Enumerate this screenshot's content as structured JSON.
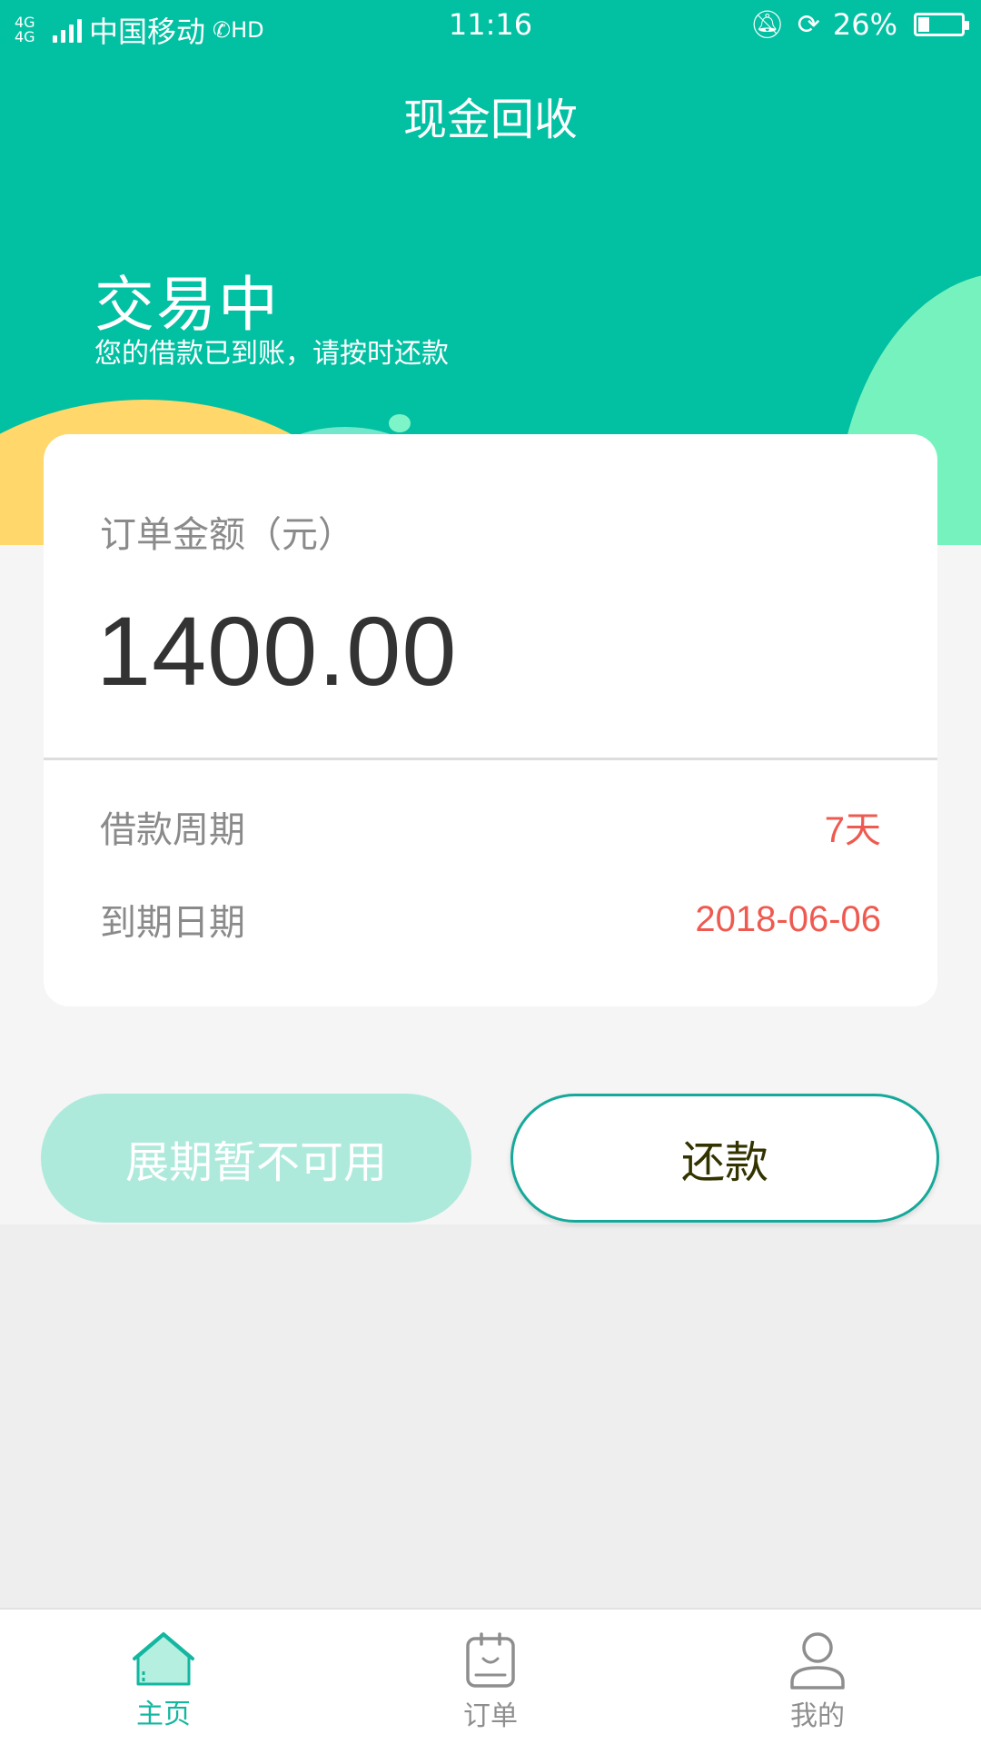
{
  "status_bar": {
    "network": "4G 4G",
    "carrier": "中国移动",
    "hd": "HD",
    "time": "11:16",
    "battery": "26%",
    "battery_level": 0.26
  },
  "header": {
    "title": "现金回收",
    "status": "交易中",
    "status_message": "您的借款已到账，请按时还款"
  },
  "card": {
    "amount_label": "订单金额（元）",
    "amount": "1400.00",
    "rows": [
      {
        "label": "借款周期",
        "value": "7天"
      },
      {
        "label": "到期日期",
        "value": "2018-06-06"
      }
    ]
  },
  "actions": {
    "extend_label": "展期暂不可用",
    "repay_label": "还款"
  },
  "tabbar": {
    "items": [
      {
        "label": "主页",
        "icon": "home-icon",
        "active": true
      },
      {
        "label": "订单",
        "icon": "order-icon",
        "active": false
      },
      {
        "label": "我的",
        "icon": "profile-icon",
        "active": false
      }
    ]
  },
  "colors": {
    "primary": "#02c0a2",
    "accent_red": "#ef5a50",
    "tab_active": "#13b7a0"
  }
}
